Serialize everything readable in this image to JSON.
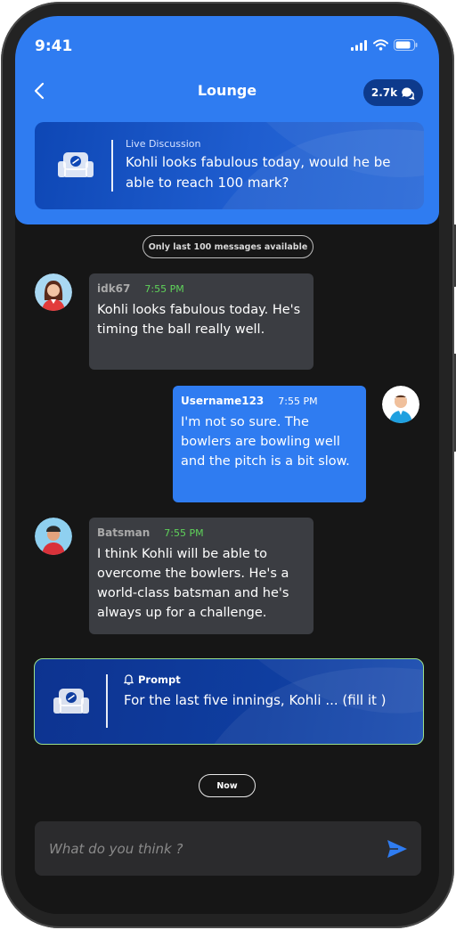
{
  "status": {
    "time": "9:41"
  },
  "header": {
    "title": "Lounge",
    "count": "2.7k"
  },
  "discussion": {
    "label": "Live Discussion",
    "text": "Kohli looks fabulous today, would he be able to reach 100 mark?"
  },
  "notice": "Only last 100 messages available",
  "messages": [
    {
      "user": "idk67",
      "time": "7:55 PM",
      "text": "Kohli looks fabulous today. He's timing the ball really well."
    },
    {
      "user": "Username123",
      "time": "7:55 PM",
      "text": "I'm not so sure. The bowlers are bowling well and the pitch is a bit slow."
    },
    {
      "user": "Batsman",
      "time": "7:55 PM",
      "text": "I think Kohli will be able to overcome the bowlers. He's a world-class batsman and he's always up for a challenge."
    }
  ],
  "prompt": {
    "label": "Prompt",
    "text": "For the last five innings, Kohli ... (fill it )"
  },
  "now_label": "Now",
  "composer": {
    "placeholder": "What do you think ?"
  },
  "colors": {
    "accent": "#2f7cf1",
    "time_green": "#5fd35a",
    "bubble_dark": "#3b3d42",
    "background": "#161616"
  },
  "icons": [
    "back-arrow-icon",
    "chat-bubbles-icon",
    "couch-icon",
    "bell-icon",
    "send-icon",
    "signal-icon",
    "wifi-icon",
    "battery-icon"
  ]
}
